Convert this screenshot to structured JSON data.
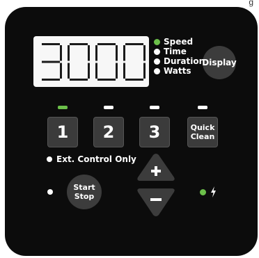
{
  "corner_text": "g",
  "display": {
    "reading": "3000"
  },
  "modes": [
    {
      "label": "Speed",
      "active": true
    },
    {
      "label": "Time",
      "active": false
    },
    {
      "label": "Duration",
      "active": false
    },
    {
      "label": "Watts",
      "active": false
    }
  ],
  "display_button": {
    "label": "Display"
  },
  "program_buttons": [
    {
      "label": "1",
      "indicator_active": true
    },
    {
      "label": "2",
      "indicator_active": false
    },
    {
      "label": "3",
      "indicator_active": false
    }
  ],
  "quick_clean": {
    "line1": "Quick",
    "line2": "Clean",
    "indicator_active": false
  },
  "ext_control": {
    "label": "Ext. Control Only"
  },
  "start_stop": {
    "line1": "Start",
    "line2": "Stop"
  },
  "speed_up": {
    "symbol": "+"
  },
  "speed_down": {
    "symbol": "−"
  },
  "power": {
    "icon": "lightning-icon",
    "led_color": "#6cc04a"
  },
  "colors": {
    "panel": "#0c0c0c",
    "button": "#3b3b3b",
    "active_led": "#6cc04a",
    "lcd_background": "#f7f7f7"
  }
}
